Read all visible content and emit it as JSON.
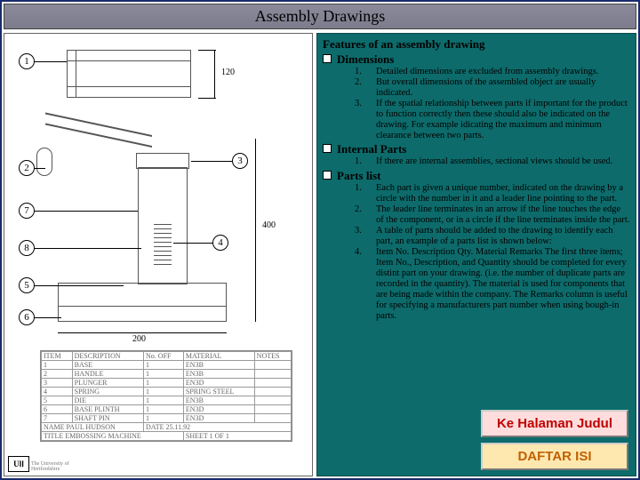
{
  "title": "Assembly Drawings",
  "features": {
    "heading": "Features of an assembly drawing",
    "sections": [
      {
        "label": "Dimensions",
        "items": [
          "Detailed dimensions are excluded from assembly drawings.",
          "But overall dimensions of the assembled object are usually indicated.",
          "If the spatial relationship between parts if important for the product to function correctly then these should also be indicated on the drawing. For example idicating the maximum and minimum clearance between two parts."
        ]
      },
      {
        "label": "Internal Parts",
        "items": [
          "If there are internal assemblies, sectional views should be used."
        ]
      },
      {
        "label": "Parts list",
        "items": [
          "Each part is given a unique number, indicated on the drawing by a circle with the number in it and a leader line pointing to the part.",
          "The leader line terminates in an arrow if the line touches the edge of the component, or in a circle if the line terminates inside the part.",
          "A table of parts should be added to the drawing to identify each part, an example of a parts list is shown below:",
          "Item No. Description Qty. Material Remarks        The first three items; Item No., Description, and Quantity should be completed for every distint part on your drawing. (i.e. the number of duplicate parts are recorded in the quantity). The material is used for components that are being made within the company. The Remarks column is useful for specifying a manufacturers part number when using bough-in parts."
        ]
      }
    ]
  },
  "buttons": {
    "judul": "Ke Halaman Judul",
    "daftar": "DAFTAR ISI"
  },
  "callouts": [
    "1",
    "2",
    "7",
    "8",
    "5",
    "6",
    "3",
    "4"
  ],
  "dims": {
    "h120": "120",
    "h400": "400",
    "w200": "200"
  },
  "parts_table": {
    "headers": [
      "ITEM",
      "DESCRIPTION",
      "No. OFF",
      "MATERIAL",
      "NOTES"
    ],
    "rows": [
      [
        "1",
        "BASE",
        "1",
        "EN3B",
        ""
      ],
      [
        "2",
        "HANDLE",
        "1",
        "EN3B",
        ""
      ],
      [
        "3",
        "PLUNGER",
        "1",
        "EN3D",
        ""
      ],
      [
        "4",
        "SPRING",
        "1",
        "SPRING STEEL",
        ""
      ],
      [
        "5",
        "DIE",
        "1",
        "EN3B",
        ""
      ],
      [
        "6",
        "BASE PLINTH",
        "1",
        "EN3D",
        ""
      ],
      [
        "7",
        "SHAFT PIN",
        "1",
        "EN3D",
        ""
      ]
    ],
    "footer": {
      "name": "NAME PAUL HUDSON",
      "date": "DATE 25.11.92",
      "title": "TITLE EMBOSSING MACHINE",
      "sheet": "SHEET 1 OF 1"
    }
  },
  "logo": "UⅠⅠ",
  "univ": "The University of Hertfordshire"
}
